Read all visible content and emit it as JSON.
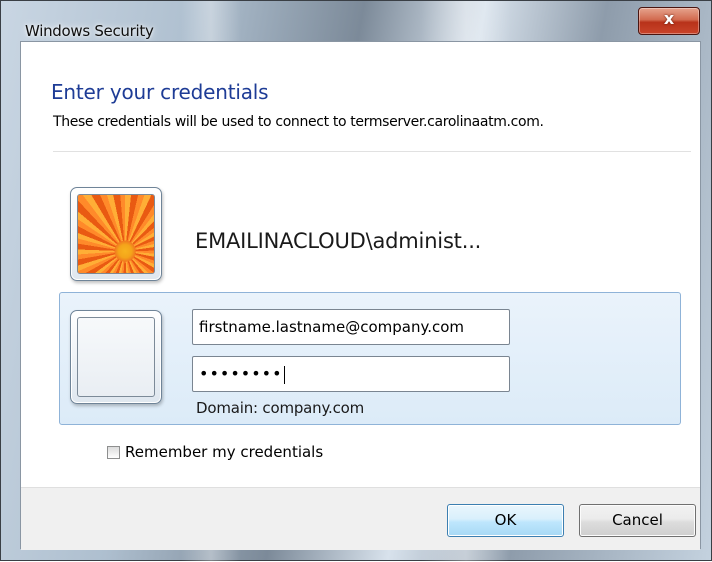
{
  "window": {
    "title": "Windows Security",
    "close_label": "x"
  },
  "header": {
    "title": "Enter your credentials",
    "description": "These credentials will be used to connect to termserver.carolinaatm.com."
  },
  "saved_account": {
    "username": "EMAILINACLOUD\\administ..."
  },
  "new_account": {
    "username_value": "firstname.lastname@company.com",
    "password_value": "••••••••",
    "domain_text": "Domain: company.com"
  },
  "remember": {
    "label": "Remember my credentials",
    "checked": false
  },
  "buttons": {
    "ok": "OK",
    "cancel": "Cancel"
  },
  "colors": {
    "heading": "#1e3c96",
    "selection_bg": "#dcebf8",
    "close_button": "#c9442a"
  }
}
